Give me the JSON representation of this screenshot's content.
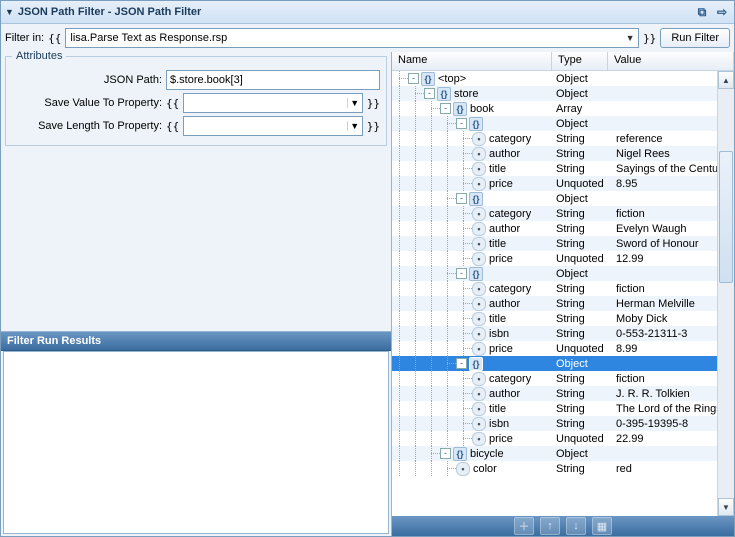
{
  "title": "JSON Path Filter - JSON Path Filter",
  "filter_label": "Filter in:",
  "filter_prefix": "{{",
  "filter_value": "lisa.Parse Text as Response.rsp",
  "filter_suffix": "}}",
  "run_button": "Run Filter",
  "attributes": {
    "legend": "Attributes",
    "json_path_label": "JSON Path:",
    "json_path_value": "$.store.book[3]",
    "save_value_label": "Save Value To Property:",
    "save_value_value": "",
    "save_length_label": "Save Length To Property:",
    "save_length_value": ""
  },
  "results_header": "Filter Run Results",
  "columns": {
    "name": "Name",
    "type": "Type",
    "value": "Value"
  },
  "tree": [
    {
      "depth": 0,
      "exp": "-",
      "icon": "obj",
      "name": "<top>",
      "type": "Object",
      "value": "",
      "sel": false
    },
    {
      "depth": 1,
      "exp": "-",
      "icon": "obj",
      "name": "store",
      "type": "Object",
      "value": "",
      "sel": false
    },
    {
      "depth": 2,
      "exp": "-",
      "icon": "obj",
      "name": "book",
      "type": "Array",
      "value": "",
      "sel": false
    },
    {
      "depth": 3,
      "exp": "-",
      "icon": "obj",
      "name": "",
      "type": "Object",
      "value": "",
      "sel": false
    },
    {
      "depth": 4,
      "exp": "",
      "icon": "prop",
      "name": "category",
      "type": "String",
      "value": "reference",
      "sel": false
    },
    {
      "depth": 4,
      "exp": "",
      "icon": "prop",
      "name": "author",
      "type": "String",
      "value": "Nigel Rees",
      "sel": false
    },
    {
      "depth": 4,
      "exp": "",
      "icon": "prop",
      "name": "title",
      "type": "String",
      "value": "Sayings of the Century",
      "sel": false
    },
    {
      "depth": 4,
      "exp": "",
      "icon": "prop",
      "name": "price",
      "type": "Unquoted",
      "value": "8.95",
      "sel": false
    },
    {
      "depth": 3,
      "exp": "-",
      "icon": "obj",
      "name": "",
      "type": "Object",
      "value": "",
      "sel": false
    },
    {
      "depth": 4,
      "exp": "",
      "icon": "prop",
      "name": "category",
      "type": "String",
      "value": "fiction",
      "sel": false
    },
    {
      "depth": 4,
      "exp": "",
      "icon": "prop",
      "name": "author",
      "type": "String",
      "value": "Evelyn Waugh",
      "sel": false
    },
    {
      "depth": 4,
      "exp": "",
      "icon": "prop",
      "name": "title",
      "type": "String",
      "value": "Sword of Honour",
      "sel": false
    },
    {
      "depth": 4,
      "exp": "",
      "icon": "prop",
      "name": "price",
      "type": "Unquoted",
      "value": "12.99",
      "sel": false
    },
    {
      "depth": 3,
      "exp": "-",
      "icon": "obj",
      "name": "",
      "type": "Object",
      "value": "",
      "sel": false
    },
    {
      "depth": 4,
      "exp": "",
      "icon": "prop",
      "name": "category",
      "type": "String",
      "value": "fiction",
      "sel": false
    },
    {
      "depth": 4,
      "exp": "",
      "icon": "prop",
      "name": "author",
      "type": "String",
      "value": "Herman Melville",
      "sel": false
    },
    {
      "depth": 4,
      "exp": "",
      "icon": "prop",
      "name": "title",
      "type": "String",
      "value": "Moby Dick",
      "sel": false
    },
    {
      "depth": 4,
      "exp": "",
      "icon": "prop",
      "name": "isbn",
      "type": "String",
      "value": "0-553-21311-3",
      "sel": false
    },
    {
      "depth": 4,
      "exp": "",
      "icon": "prop",
      "name": "price",
      "type": "Unquoted",
      "value": "8.99",
      "sel": false
    },
    {
      "depth": 3,
      "exp": "-",
      "icon": "obj",
      "name": "",
      "type": "Object",
      "value": "",
      "sel": true
    },
    {
      "depth": 4,
      "exp": "",
      "icon": "prop",
      "name": "category",
      "type": "String",
      "value": "fiction",
      "sel": false
    },
    {
      "depth": 4,
      "exp": "",
      "icon": "prop",
      "name": "author",
      "type": "String",
      "value": "J. R. R. Tolkien",
      "sel": false
    },
    {
      "depth": 4,
      "exp": "",
      "icon": "prop",
      "name": "title",
      "type": "String",
      "value": "The Lord of the Rings",
      "sel": false
    },
    {
      "depth": 4,
      "exp": "",
      "icon": "prop",
      "name": "isbn",
      "type": "String",
      "value": "0-395-19395-8",
      "sel": false
    },
    {
      "depth": 4,
      "exp": "",
      "icon": "prop",
      "name": "price",
      "type": "Unquoted",
      "value": "22.99",
      "sel": false
    },
    {
      "depth": 2,
      "exp": "-",
      "icon": "obj",
      "name": "bicycle",
      "type": "Object",
      "value": "",
      "sel": false
    },
    {
      "depth": 3,
      "exp": "",
      "icon": "prop",
      "name": "color",
      "type": "String",
      "value": "red",
      "sel": false
    }
  ],
  "toolbar_icons": [
    "＋",
    "↑",
    "↓",
    "▦"
  ]
}
